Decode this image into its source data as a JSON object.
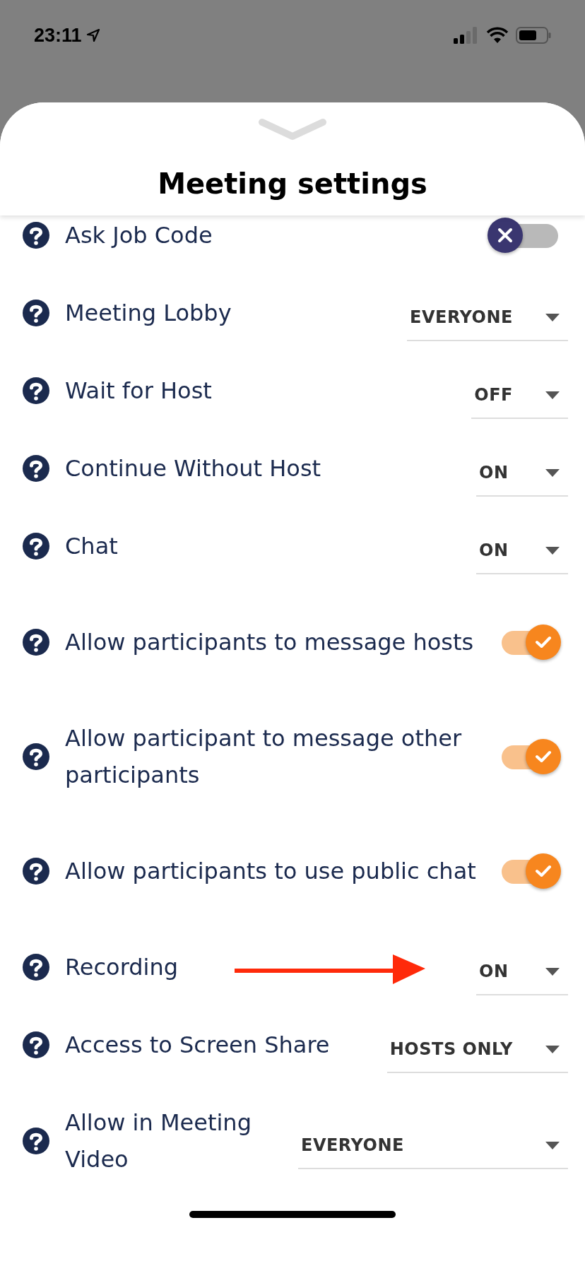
{
  "status_bar": {
    "time": "23:11"
  },
  "sheet": {
    "title": "Meeting settings",
    "settings": [
      {
        "kind": "toggle",
        "label": "Ask Job Code",
        "on": false
      },
      {
        "kind": "dropdown",
        "label": "Meeting Lobby",
        "value": "EVERYONE"
      },
      {
        "kind": "dropdown",
        "label": "Wait for Host",
        "value": "OFF"
      },
      {
        "kind": "dropdown",
        "label": "Continue Without Host",
        "value": "ON"
      },
      {
        "kind": "dropdown",
        "label": "Chat",
        "value": "ON"
      },
      {
        "kind": "toggle",
        "label": "Allow participants to message hosts",
        "on": true
      },
      {
        "kind": "toggle",
        "label": "Allow participant to message other participants",
        "on": true
      },
      {
        "kind": "toggle",
        "label": "Allow participants to use public chat",
        "on": true
      },
      {
        "kind": "dropdown",
        "label": "Recording",
        "value": "ON",
        "annotated": true
      },
      {
        "kind": "dropdown",
        "label": "Access to Screen Share",
        "value": "HOSTS ONLY"
      },
      {
        "kind": "dropdown",
        "label": "Allow in Meeting Video",
        "value": "EVERYONE"
      }
    ]
  }
}
